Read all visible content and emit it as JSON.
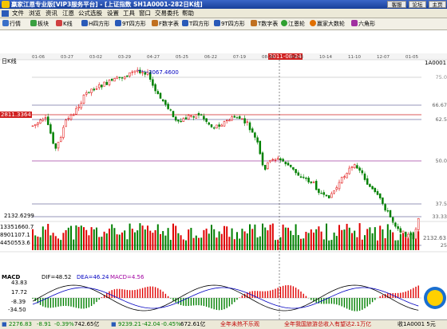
{
  "titlebar": {
    "title": "赢家江恩专业版[VIP3服务平台] - [上证指数  SH1A0001-282日K线]",
    "buttons": [
      "客服",
      "论坛",
      "主页"
    ]
  },
  "menu": [
    "文件",
    "浏览",
    "资讯",
    "江恩",
    "公式选股",
    "设置",
    "工具",
    "窗口",
    "交易委托",
    "帮助"
  ],
  "toolbar": [
    "行情",
    "板块",
    "K线",
    "H四方形",
    "9T四方形",
    "F数字表",
    "T四方形",
    "9T四方形",
    "T数字表",
    "江恩轮",
    "赢家大数轮",
    "六角形"
  ],
  "chart": {
    "label": "日K线",
    "code": "1A0001",
    "date_axis": [
      "01-06",
      "03-27",
      "03-02",
      "03-29",
      "04-27",
      "05-25",
      "06-22",
      "07-19",
      "08-16",
      "09-13",
      "10-14",
      "11-10",
      "12-07",
      "01-05"
    ],
    "cursor_date": "2011-08-24",
    "cursor_value": "2811.3364",
    "high_label": "3067.4600",
    "low_label": "2132.6299",
    "low_right_label": "2132.63",
    "gann_lines": [
      "75.0",
      "66.67",
      "62.5",
      "50.0",
      "37.5",
      "33.33",
      "25"
    ],
    "volume_labels": [
      "13351660.7",
      "8901107.1",
      "4450553.6"
    ]
  },
  "macd": {
    "name": "MACD",
    "dif": "DIF=48.52",
    "dea": "DEA=46.24",
    "macd": "MACD=4.56",
    "axis": [
      "43.83",
      "17.72",
      "-8.39",
      "-34.50"
    ]
  },
  "statusbar": {
    "sh": "2276.83",
    "sh_chg": "-8.91",
    "sh_pct": "-0.39%",
    "sh_vol": "742.65亿",
    "sz": "9239.21",
    "sz_chg": "-42.04",
    "sz_pct": "-0.45%",
    "sz_vol": "672.61亿",
    "news1": "全年未热不乐观",
    "news2": "全年我国旅游总收入有望达2.1万亿",
    "right": "收1A0001 5元"
  },
  "colors": {
    "up": "#e00000",
    "down": "#008000",
    "accent": "#2a5ab8"
  }
}
